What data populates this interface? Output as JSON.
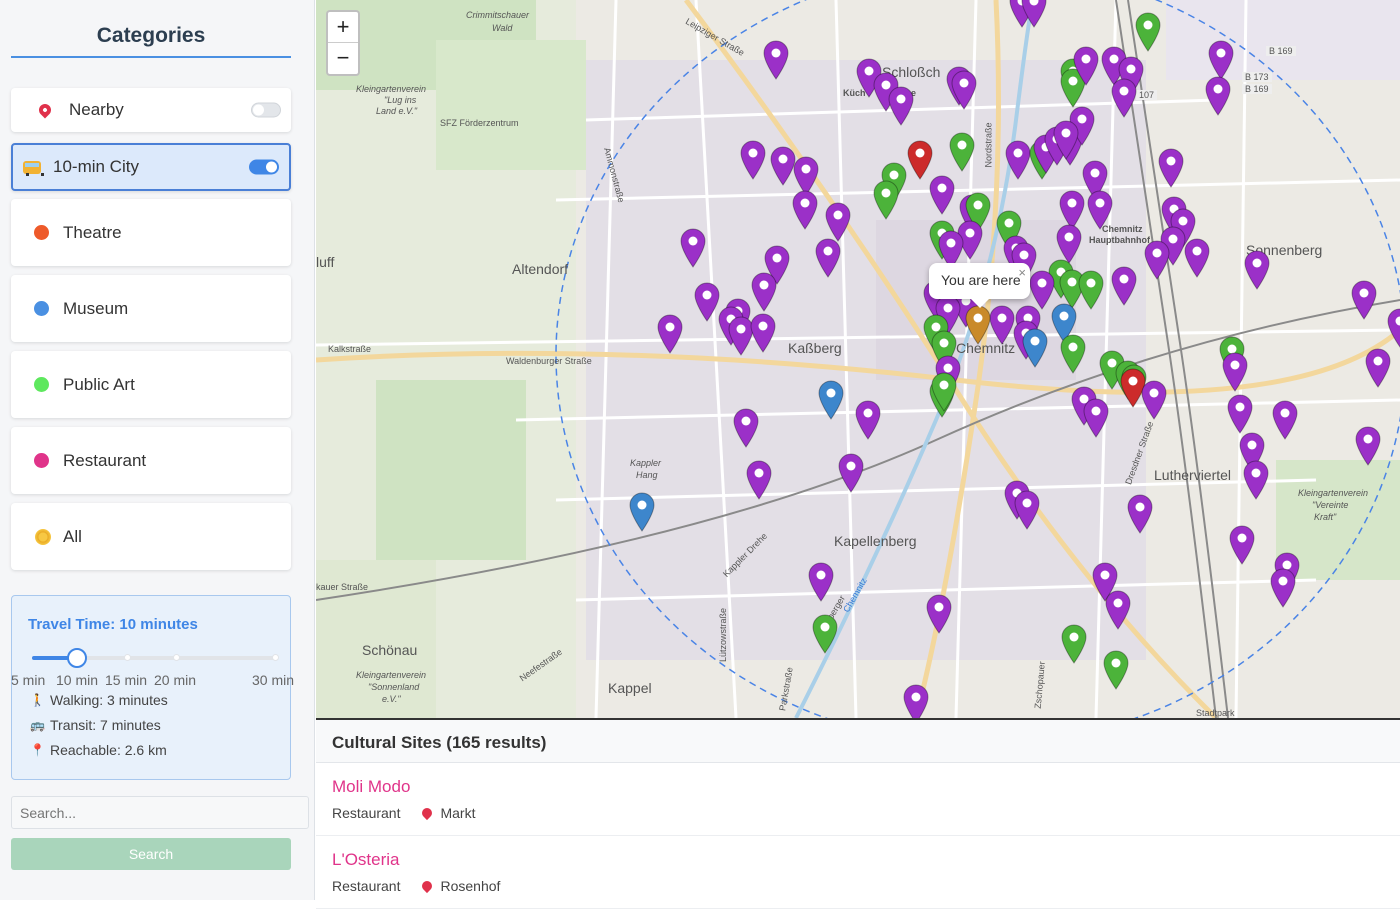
{
  "sidebar": {
    "title": "Categories",
    "categories": [
      {
        "label": "Nearby",
        "icon": "pin-icon",
        "toggle": false
      },
      {
        "label": "10-min City",
        "icon": "bus-icon",
        "toggle": true
      },
      {
        "label": "Theatre",
        "icon": "dot",
        "color": "#ee5a2a"
      },
      {
        "label": "Museum",
        "icon": "dot",
        "color": "#4a90e2"
      },
      {
        "label": "Public Art",
        "icon": "dot",
        "color": "#5ee85e"
      },
      {
        "label": "Restaurant",
        "icon": "dot",
        "color": "#e0348a"
      },
      {
        "label": "All",
        "icon": "star-icon"
      }
    ],
    "travel": {
      "title": "Travel Time: 10 minutes",
      "value_minutes": 10,
      "ticks": [
        "5 min",
        "10 min",
        "15 min",
        "20 min",
        "30 min"
      ],
      "walking": "Walking: 3 minutes",
      "transit": "Transit: 7 minutes",
      "reachable": "Reachable: 2.6 km"
    },
    "search": {
      "placeholder": "Search...",
      "button": "Search"
    }
  },
  "map": {
    "zoom_in": "+",
    "zoom_out": "−",
    "popup": "You are here",
    "popup_close": "×",
    "labels": {
      "crimmitschauer": "Crimmitschauer",
      "wald": "Wald",
      "kleingarten1": "Kleingartenverein",
      "lug_ins": "\"Lug ins",
      "land": "Land e.V.\"",
      "sfz": "SFZ Förderzentrum",
      "schlossch": "Schloßch",
      "kuechwald": "Küch",
      "se": "se",
      "altendorf": "Altendorf",
      "kassberg": "Kaßberg",
      "chemnitz": "Chemnitz",
      "kalkstrasse": "Kalkstraße",
      "waldenburger": "Waldenburger Straße",
      "kappler_hang1": "Kappler",
      "kappler_hang2": "Hang",
      "kapellenberg": "Kapellenberg",
      "schoenau": "Schönau",
      "kleingarten2": "Kleingartenverein",
      "sonnenland": "\"Sonnenland",
      "ev": "e.V.\"",
      "kappel": "Kappel",
      "sonnenberg": "Sonnenberg",
      "lutherviertel": "Lutherviertel",
      "kleingarten3": "Kleingartenverein",
      "vereinte": "\"Vereinte",
      "kraft": "Kraft\"",
      "hbf1": "Chemnitz",
      "hbf2": "Hauptbahnhof",
      "luff": "luff",
      "kauer": "kauer Straße",
      "b169": "B 169",
      "b173": "B 173",
      "b169b": "B 169",
      "r107": "107",
      "leipziger": "Leipziger Straße",
      "ammonstr": "Ammonstraße",
      "nordstr": "Nordstraße",
      "dresdner": "Dresdner Straße",
      "kappler_drehe": "Kappler Drehe",
      "luetzow": "Lützowstraße",
      "parkstr": "Parkstraße",
      "stollberger": "Stollberger",
      "neefestr": "Neefestraße",
      "zschopauer": "Zschopauer",
      "chemnitz_river": "Chemnitz",
      "stadtpark": "Stadtpark"
    }
  },
  "results": {
    "header": "Cultural Sites (165 results)",
    "items": [
      {
        "name": "Moli Modo",
        "type": "Restaurant",
        "place": "Markt"
      },
      {
        "name": "L'Osteria",
        "type": "Restaurant",
        "place": "Rosenhof"
      }
    ]
  }
}
